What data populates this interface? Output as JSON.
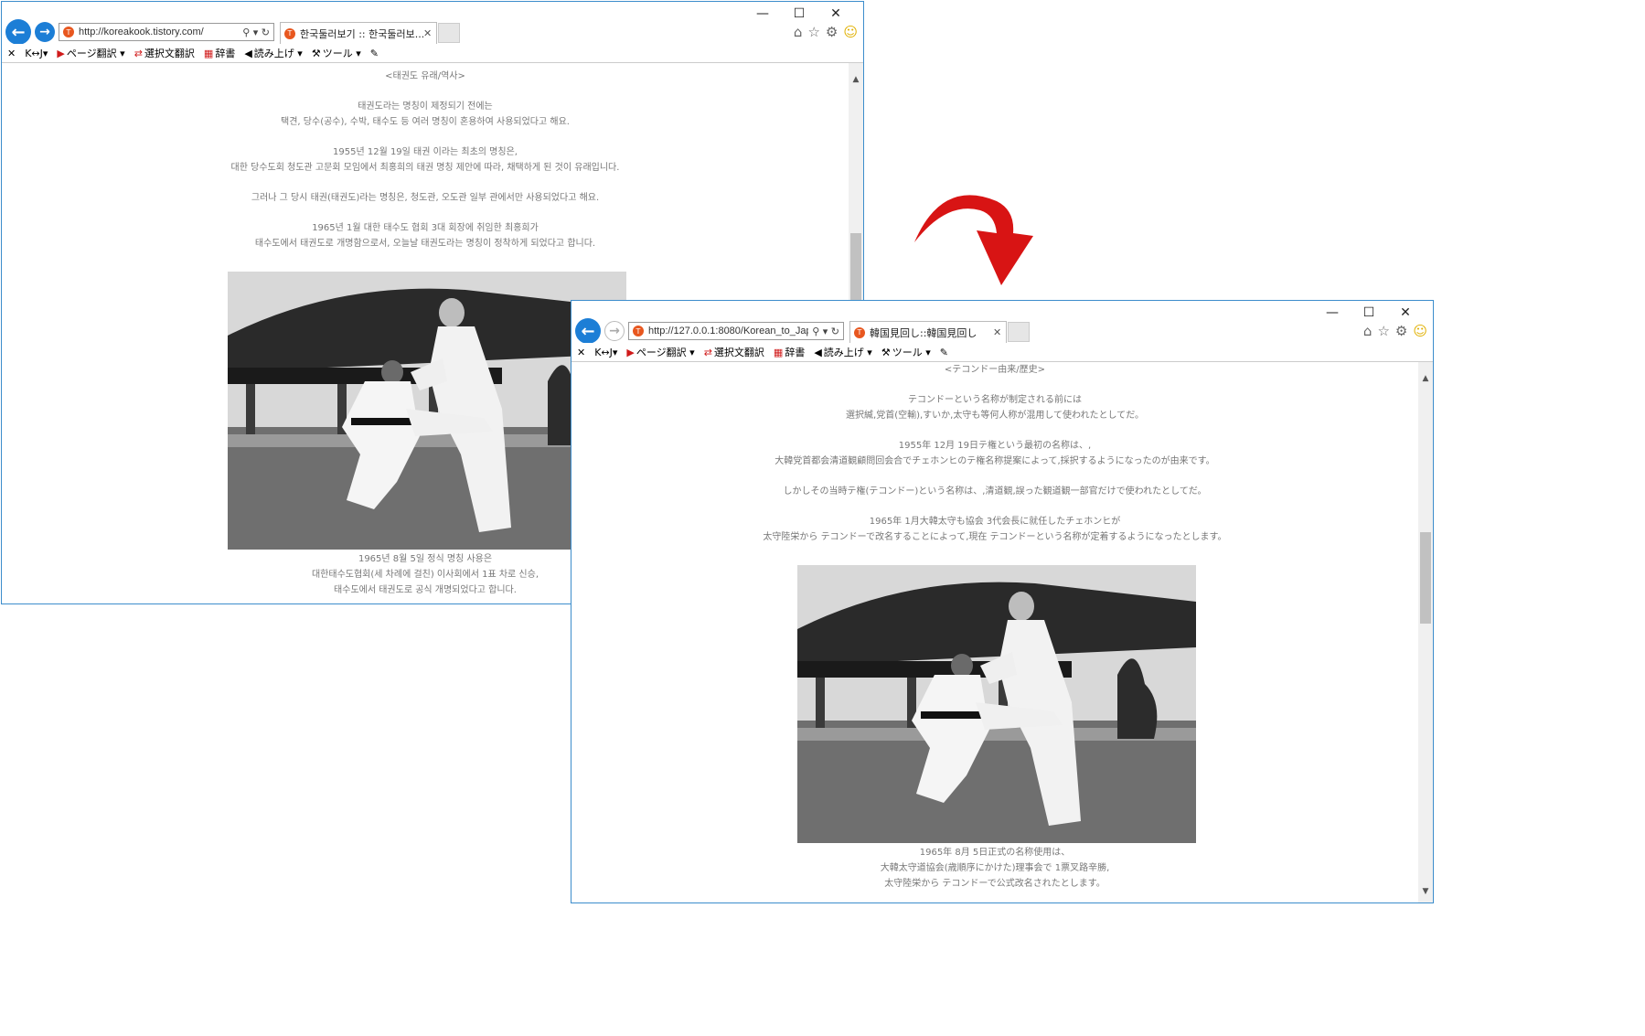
{
  "window1": {
    "url": "http://koreakook.tistory.com/",
    "tab_title": "한국둘러보기 :: 한국둘러보...",
    "controls": {
      "minimize": "—",
      "maximize": "☐",
      "close": "✕"
    },
    "toolbar": {
      "close_x": "✕",
      "kj": "K↔J▾",
      "page_translate": "ページ翻訳 ▾",
      "selection_translate": "選択文翻訳",
      "dictionary": "辞書",
      "read_aloud": "読み上げ ▾",
      "tools": "ツール ▾"
    },
    "content": {
      "heading": "<태권도 유래/역사>",
      "p1_line1": "태권도라는 명칭이 제정되기 전에는",
      "p1_line2": "택견, 당수(공수), 수박, 태수도 등 여러 명칭이 혼용하여 사용되었다고 해요.",
      "p2_line1": "1955년 12월 19일 태권 이라는 최초의 명칭은,",
      "p2_line2": "대한 당수도회 청도관 고문회 모임에서 최홍희의 태권 명칭 제안에 따라, 채택하게 된 것이 유래입니다.",
      "p3_line1": "그러나 그 당시 태권(태권도)라는 명칭은, 청도관, 오도관 일부 관에서만 사용되었다고 해요.",
      "p4_line1": "1965년 1월 대한 태수도 협회 3대 회장에 취임한 최홍희가",
      "p4_line2": "태수도에서 태권도로 개명함으로서, 오늘날 태권도라는 명칭이 정착하게 되었다고 합니다.",
      "cap_line1": "1965년 8월 5일 정식 명칭 사용은",
      "cap_line2": "대한태수도협회(세 차례에 걸친) 이사회에서 1표 차로 신승,",
      "cap_line3": "태수도에서 태권도로 공식 개명되었다고 합니다."
    }
  },
  "window2": {
    "url": "http://127.0.0.1:8080/Korean_to_Japa",
    "tab_title": "韓国見回し::韓国見回し",
    "controls": {
      "minimize": "—",
      "maximize": "☐",
      "close": "✕"
    },
    "toolbar": {
      "close_x": "✕",
      "kj": "K↔J▾",
      "page_translate": "ページ翻訳 ▾",
      "selection_translate": "選択文翻訳",
      "dictionary": "辞書",
      "read_aloud": "読み上げ ▾",
      "tools": "ツール ▾"
    },
    "content": {
      "heading": "<テコンドー由来/歴史>",
      "p1_line1": "テコンドーという名称が制定される前には",
      "p1_line2": "選択緘,党首(空輸),すいか,太守も等何人称が混用して使われたとしてだ。",
      "p2_line1": "1955年 12月 19日テ権という最初の名称は、,",
      "p2_line2": "大韓党首都会清道観顧問回会合でチェホンヒのテ権名称提案によって,採択するようになったのが由来です。",
      "p3_line1": "しかしその当時テ権(テコンドー)という名称は、,清道観,誤った観道観一部官だけで使われたとしてだ。",
      "p4_line1": "1965年 1月大韓太守も協会 3代会長に就任したチェホンヒが",
      "p4_line2": "太守陸栄から テコンドーで改名することによって,現在 テコンドーという名称が定着するようになったとします。",
      "cap_line1": "1965年 8月 5日正式の名称使用は、",
      "cap_line2": "大韓太守道協会(歳順序にかけた)理事会で 1票叉路辛勝,",
      "cap_line3": "太守陸栄から テコンドーで公式改名されたとします。"
    }
  },
  "colors": {
    "accent_blue": "#1c7ed6",
    "window_border": "#3c8dcc",
    "arrow_red": "#d81414",
    "text_gray": "#777777"
  },
  "icons": [
    "back-arrow-icon",
    "forward-arrow-icon",
    "search-icon",
    "refresh-icon",
    "home-icon",
    "star-icon",
    "gear-icon",
    "smiley-icon",
    "red-curved-arrow-icon"
  ]
}
